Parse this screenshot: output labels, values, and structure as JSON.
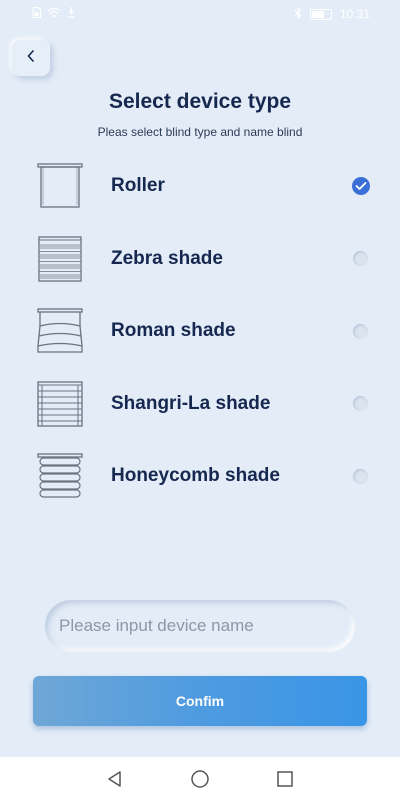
{
  "status_bar": {
    "time": "10:31",
    "icons": [
      "sim-icon",
      "wifi-icon",
      "notification-icon",
      "bluetooth-icon",
      "battery-icon"
    ]
  },
  "header": {
    "back_icon": "chevron-left-icon",
    "title": "Select device type",
    "subtitle": "Pleas select blind type and name blind"
  },
  "devices": [
    {
      "label": "Roller",
      "icon": "roller-blind-icon",
      "selected": true
    },
    {
      "label": "Zebra shade",
      "icon": "zebra-shade-icon",
      "selected": false
    },
    {
      "label": "Roman shade",
      "icon": "roman-shade-icon",
      "selected": false
    },
    {
      "label": "Shangri-La shade",
      "icon": "shangri-la-shade-icon",
      "selected": false
    },
    {
      "label": "Honeycomb shade",
      "icon": "honeycomb-shade-icon",
      "selected": false
    }
  ],
  "name_input": {
    "value": "",
    "placeholder": "Please input device name"
  },
  "confirm_label": "Confim",
  "nav_bar": {
    "icons": [
      "back-triangle-icon",
      "home-circle-icon",
      "recents-square-icon"
    ]
  },
  "colors": {
    "background": "#e3ecf7",
    "title": "#16284f",
    "accent": "#3b6fd8",
    "button_gradient_start": "#6fa7d6",
    "button_gradient_end": "#3a95e6"
  }
}
